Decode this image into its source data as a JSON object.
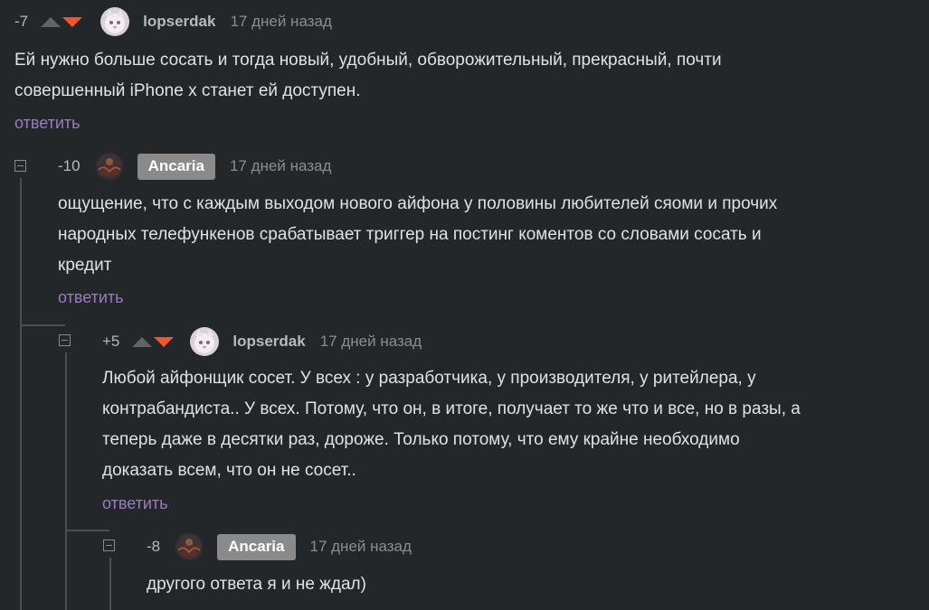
{
  "comments": [
    {
      "rating": "-7",
      "username": "lopserdak",
      "time": "17 дней назад",
      "text": "Ей нужно больше сосать и тогда новый, удобный, обворожительный, прекрасный, почти\nсовершенный iPhone x станет ей доступен.",
      "reply": "ответить"
    },
    {
      "rating": "-10",
      "username": "Ancaria",
      "time": "17 дней назад",
      "text": "ощущение, что с каждым выходом нового айфона у половины любителей сяоми и прочих\nнародных телефункенов срабатывает триггер на постинг коментов со словами сосать и\nкредит",
      "reply": "ответить"
    },
    {
      "rating": "+5",
      "username": "lopserdak",
      "time": "17 дней назад",
      "text": "Любой айфонщик сосет. У всех : у разработчика, у производителя, у ритейлера, у\nконтрабандиста.. У всех. Потому, что он, в итоге, получает то же что и все, но в разы, а\nтеперь даже в десятки раз, дороже. Только потому, что ему крайне необходимо\nдоказать всем, что он не сосет..",
      "reply": "ответить"
    },
    {
      "rating": "-8",
      "username": "Ancaria",
      "time": "17 дней назад",
      "text": "другого ответа я и не ждал)"
    }
  ],
  "colors": {
    "background": "#23272a",
    "reply_link": "#9a7cbf",
    "vote_down": "#f2572c",
    "vote_up": "#636363",
    "badge": "#8a8a8a"
  },
  "icons": {
    "collapse": "minus-square-icon",
    "vote_up": "triangle-up-icon",
    "vote_down": "triangle-down-icon",
    "avatar_cat": "cat-avatar",
    "avatar_dark": "dark-figure-avatar"
  }
}
